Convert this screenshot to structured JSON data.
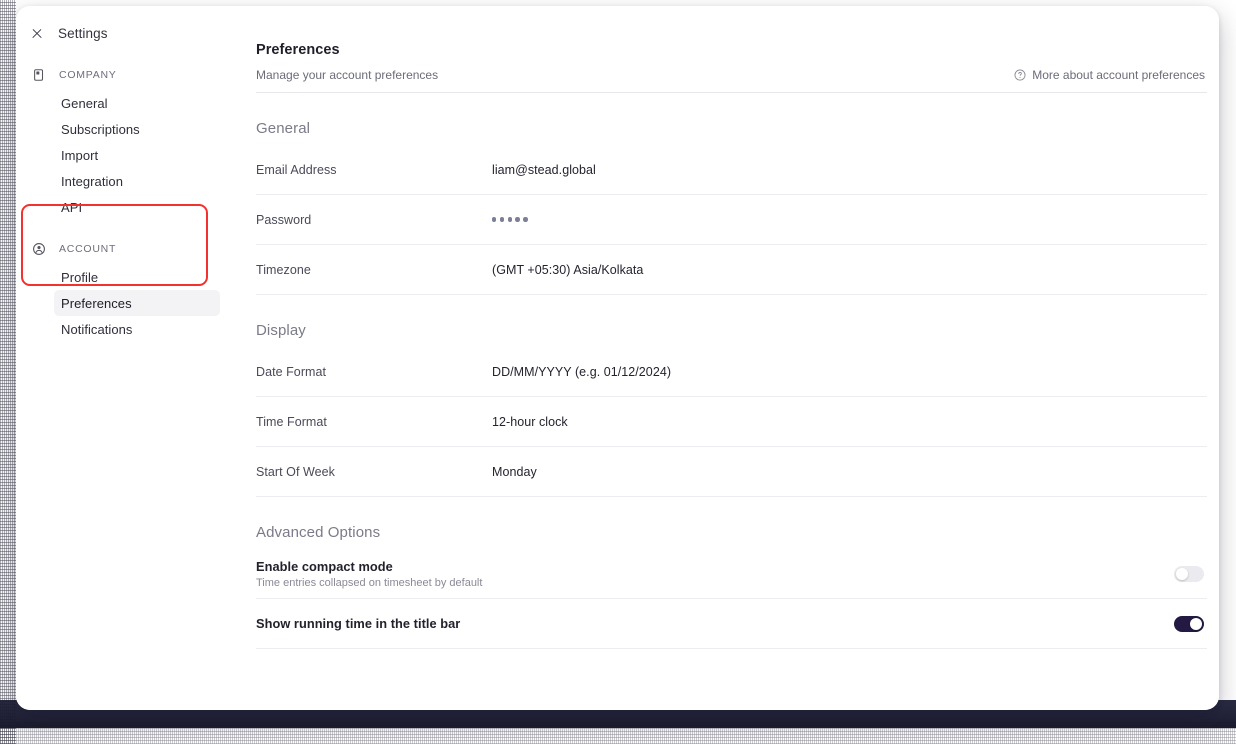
{
  "window": {
    "title": "Settings",
    "close_icon": "close-icon"
  },
  "sidebar": {
    "groups": [
      {
        "label": "COMPANY",
        "icon": "building-icon",
        "items": [
          {
            "label": "General",
            "selected": false
          },
          {
            "label": "Subscriptions",
            "selected": false
          },
          {
            "label": "Import",
            "selected": false
          },
          {
            "label": "Integration",
            "selected": false
          },
          {
            "label": "API",
            "selected": false
          }
        ]
      },
      {
        "label": "ACCOUNT",
        "icon": "user-circle-icon",
        "items": [
          {
            "label": "Profile",
            "selected": false
          },
          {
            "label": "Preferences",
            "selected": true
          },
          {
            "label": "Notifications",
            "selected": false
          }
        ]
      }
    ],
    "highlight_color": "#f3312f"
  },
  "header": {
    "title": "Preferences",
    "subtitle": "Manage your account preferences",
    "help_link": "More about account preferences",
    "help_icon": "question-circle-icon"
  },
  "sections": [
    {
      "title": "General",
      "rows": [
        {
          "label": "Email Address",
          "value": "liam@stead.global",
          "type": "text"
        },
        {
          "label": "Password",
          "value": "•••••",
          "type": "password",
          "dots": 5
        },
        {
          "label": "Timezone",
          "value": "(GMT +05:30) Asia/Kolkata",
          "type": "text"
        }
      ]
    },
    {
      "title": "Display",
      "rows": [
        {
          "label": "Date Format",
          "value": "DD/MM/YYYY (e.g. 01/12/2024)",
          "type": "text"
        },
        {
          "label": "Time Format",
          "value": "12-hour clock",
          "type": "text"
        },
        {
          "label": "Start Of Week",
          "value": "Monday",
          "type": "text"
        }
      ]
    }
  ],
  "advanced": {
    "title": "Advanced Options",
    "rows": [
      {
        "title": "Enable compact mode",
        "desc": "Time entries collapsed on timesheet by default",
        "toggle": "off"
      },
      {
        "title": "Show running time in the title bar",
        "desc": "",
        "toggle": "on"
      }
    ]
  },
  "colors": {
    "toggle_on": "#231942",
    "toggle_off": "#ebebef",
    "annotation": "#f3312f"
  }
}
